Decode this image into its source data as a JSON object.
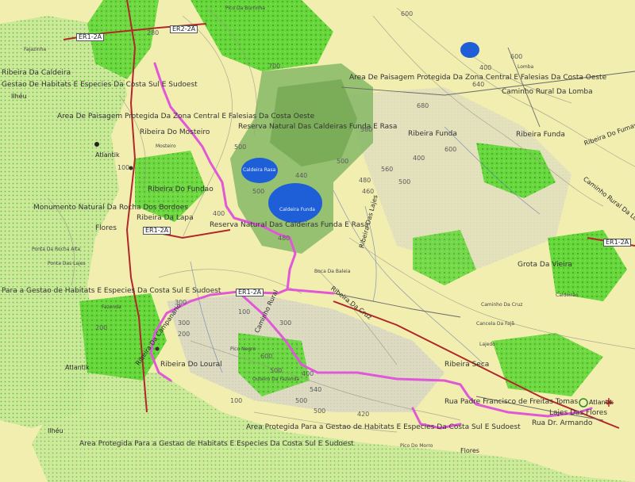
{
  "map": {
    "road_labels": [
      {
        "id": "r1",
        "text": "ER1-2A"
      },
      {
        "id": "r2",
        "text": "ER2-2A"
      },
      {
        "id": "r3",
        "text": "ER1-2A"
      },
      {
        "id": "r4",
        "text": "ER1-2A"
      },
      {
        "id": "r5",
        "text": "ER1-2A"
      }
    ],
    "place_labels": [
      {
        "id": "p1",
        "text": "Ribeira Da Caldeira"
      },
      {
        "id": "p2",
        "text": "Gestao De Habitats E Especies Da Costa Sul E Sudoest"
      },
      {
        "id": "p3",
        "text": "Ilhéu"
      },
      {
        "id": "p4",
        "text": "Area De Paisagem Protegida Da Zona Central E Falesias Da Costa Oeste"
      },
      {
        "id": "p5",
        "text": "Ribeira Do Mosteiro"
      },
      {
        "id": "p6",
        "text": "Atlantik"
      },
      {
        "id": "p7",
        "text": "Ribeira Do Fundao"
      },
      {
        "id": "p8",
        "text": "Monumento Natural Da Rocha Dos Bordoes"
      },
      {
        "id": "p9",
        "text": "Ribeira Da Lapa"
      },
      {
        "id": "p10",
        "text": "Flores"
      },
      {
        "id": "p11",
        "text": "Reserva Natural Das Caldeiras Funda E Rasa"
      },
      {
        "id": "p12",
        "text": "Reserva Natural Das Caldeiras Funda E Rasa"
      },
      {
        "id": "p13",
        "text": "Area De Paisagem Protegida Da Zona Central E Falesias Da Costa Oeste"
      },
      {
        "id": "p14",
        "text": "Caminho Rural Da Lomba"
      },
      {
        "id": "p15",
        "text": "Ribeira Funda"
      },
      {
        "id": "p16",
        "text": "Ribeira Funda"
      },
      {
        "id": "p17",
        "text": "Grota Da Vieira"
      },
      {
        "id": "p18",
        "text": "Para a Gestao de Habitats E Especies Da Costa Sul E Sudoest"
      },
      {
        "id": "p19",
        "text": "Ribeira Do Loural"
      },
      {
        "id": "p20",
        "text": "Atlantik"
      },
      {
        "id": "p21",
        "text": "Ribeira Seca"
      },
      {
        "id": "p22",
        "text": "Rua Padre Francisco de Freitas Tomas"
      },
      {
        "id": "p23",
        "text": "Area Protegida Para a Gestao de Habitats E Especies Da Costa Sul E Sudoest"
      },
      {
        "id": "p24",
        "text": "Area Protegida Para a Gestao de Habitats E Especies Da Costa Sul E Sudoest"
      },
      {
        "id": "p25",
        "text": "Lajes Das Flores"
      },
      {
        "id": "p26",
        "text": "Rua Dr. Armando"
      },
      {
        "id": "p27",
        "text": "Atlantik"
      },
      {
        "id": "p28",
        "text": "Ribeira Das Lajes"
      },
      {
        "id": "p29",
        "text": "Ribeira Da Cruz"
      },
      {
        "id": "p30",
        "text": "Caminho Rural Da Lomba"
      },
      {
        "id": "p31",
        "text": "Ribeira Do Fumay"
      },
      {
        "id": "p32",
        "text": "Ilhéu"
      },
      {
        "id": "p33",
        "text": "Flores"
      },
      {
        "id": "p34",
        "text": "Caminho Rural"
      },
      {
        "id": "p35",
        "text": "Ribeira Da Campanario"
      }
    ],
    "lake_labels": [
      {
        "id": "l1",
        "text": "Caldeira Rasa"
      },
      {
        "id": "l2",
        "text": "Caldeira Funda"
      }
    ],
    "elevation_labels": [
      "280",
      "700",
      "600",
      "500",
      "600",
      "400",
      "640",
      "680",
      "500",
      "440",
      "480",
      "400",
      "560",
      "580",
      "460",
      "400",
      "480",
      "300",
      "100",
      "300",
      "200",
      "300",
      "600",
      "500",
      "400",
      "500",
      "540",
      "500",
      "420",
      "100",
      "200",
      "100",
      "500",
      "500",
      "600"
    ],
    "minor_labels": [
      {
        "id": "m1",
        "text": "Ponta Das Lajes"
      },
      {
        "id": "m2",
        "text": "Boca Da Baleia"
      },
      {
        "id": "m3",
        "text": "Caminho Da Cruz"
      },
      {
        "id": "m4",
        "text": "Pico Da Burrinha"
      },
      {
        "id": "m5",
        "text": "Lomba"
      },
      {
        "id": "m6",
        "text": "Fajazinha"
      },
      {
        "id": "m7",
        "text": "Lajedo"
      },
      {
        "id": "m8",
        "text": "Mosteiro"
      },
      {
        "id": "m9",
        "text": "Fazenda"
      },
      {
        "id": "m10",
        "text": "Outeiro Da Fazenda"
      },
      {
        "id": "m11",
        "text": "Pico Negro"
      },
      {
        "id": "m12",
        "text": "Pico Do Morro"
      },
      {
        "id": "m13",
        "text": "Ponta Da Rocha Alta"
      },
      {
        "id": "m14",
        "text": "Cancela Da Fajã"
      },
      {
        "id": "m15",
        "text": "Caldeirão"
      }
    ],
    "colors": {
      "land": "#f1eeb0",
      "forest": "#55d42c",
      "protected_dark": "#7fb85a",
      "lake": "#1e5fd8",
      "route": "#e058d8",
      "main_road": "#b0282a",
      "contour": "#9a9a86"
    }
  }
}
